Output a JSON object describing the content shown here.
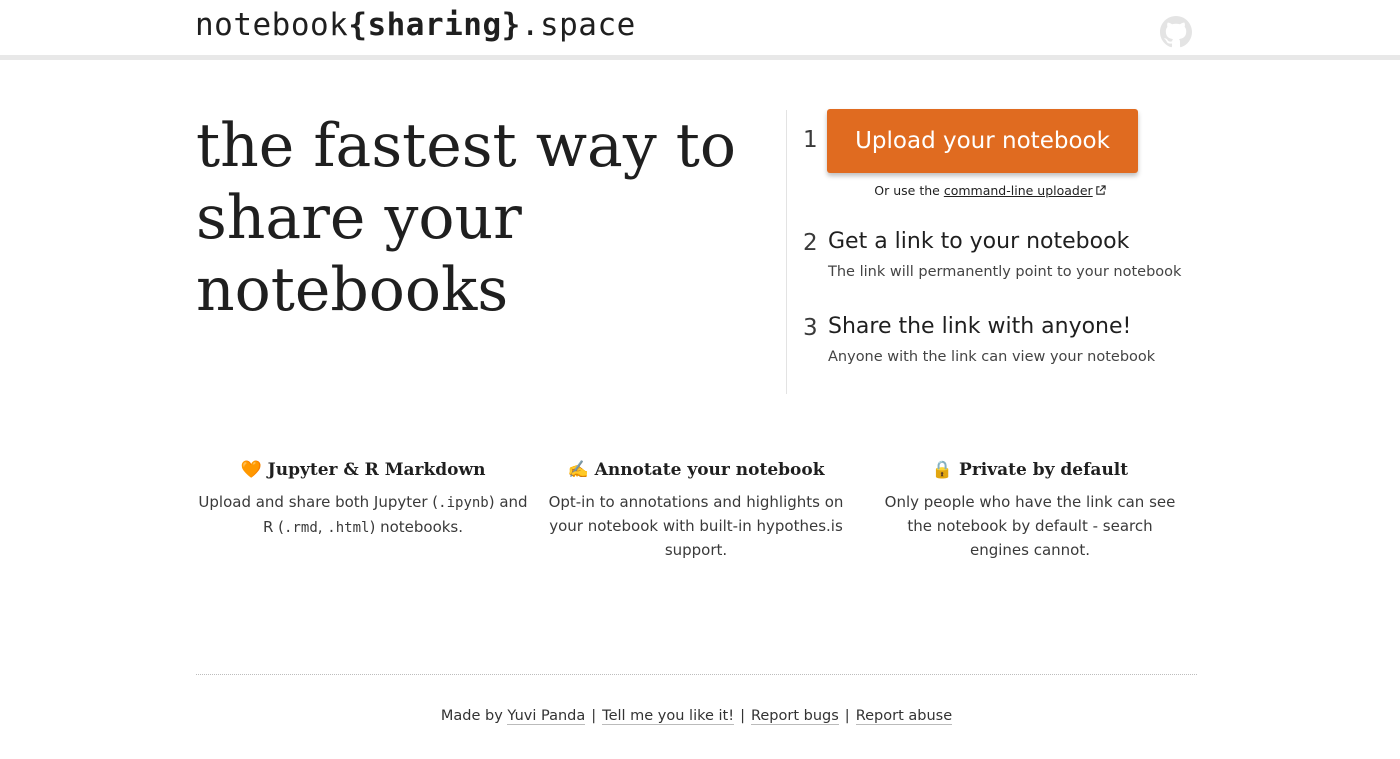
{
  "header": {
    "brand_prefix": "notebook",
    "brand_open": "{",
    "brand_bold": "sharing",
    "brand_close": "}",
    "brand_suffix": ".space",
    "github_icon": "github-icon"
  },
  "hero": {
    "line1": "the fastest way to",
    "line2": "share your",
    "line3": "notebooks"
  },
  "steps": [
    {
      "number": "1",
      "button_label": "Upload your notebook",
      "alt_prefix": "Or use the ",
      "alt_link": "command-line uploader"
    },
    {
      "number": "2",
      "title": "Get a link to your notebook",
      "desc": "The link will permanently point to your notebook"
    },
    {
      "number": "3",
      "title": "Share the link with anyone!",
      "desc": "Anyone with the link can view your notebook"
    }
  ],
  "features": [
    {
      "emoji": "🧡",
      "title": "Jupyter & R Markdown",
      "desc_1": "Upload and share both Jupyter (",
      "code_1": ".ipynb",
      "desc_2": ") and R (",
      "code_2": ".rmd",
      "desc_3": ", ",
      "code_3": ".html",
      "desc_4": ") notebooks."
    },
    {
      "emoji": "✍️",
      "title": "Annotate your notebook",
      "desc": "Opt-in to annotations and highlights on your notebook with built-in hypothes.is support."
    },
    {
      "emoji": "🔒",
      "title": "Private by default",
      "desc": "Only people who have the link can see the notebook by default - search engines cannot."
    }
  ],
  "footer": {
    "made_by": "Made by ",
    "author": "Yuvi Panda",
    "sep": "|",
    "like": "Tell me you like it!",
    "bugs": "Report bugs",
    "abuse": "Report abuse"
  },
  "colors": {
    "accent": "#e06b20"
  }
}
